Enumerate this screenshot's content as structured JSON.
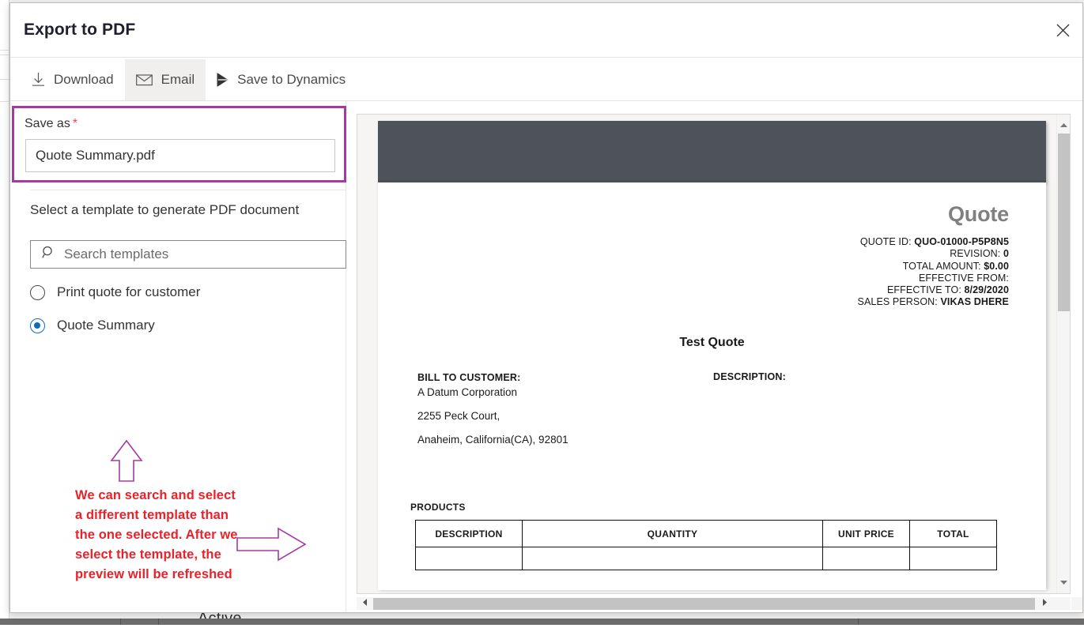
{
  "background": {
    "bottom_text": "Active"
  },
  "dialog": {
    "title": "Export to PDF",
    "close_icon": "close-icon"
  },
  "command_bar": {
    "items": [
      {
        "label": "Download",
        "icon": "download-icon",
        "selected": false
      },
      {
        "label": "Email",
        "icon": "envelope-icon",
        "selected": true
      },
      {
        "label": "Save to Dynamics",
        "icon": "send-icon",
        "selected": false
      }
    ]
  },
  "left_panel": {
    "save_as": {
      "label": "Save as",
      "required_marker": "*",
      "value": "Quote Summary.pdf",
      "highlight_color": "#a33ba3"
    },
    "template_section": {
      "label": "Select a template to generate PDF document",
      "search": {
        "placeholder": "Search templates",
        "value": "",
        "icon": "search-icon"
      },
      "options": [
        {
          "label": "Print quote for customer",
          "selected": false
        },
        {
          "label": "Quote Summary",
          "selected": true
        }
      ]
    },
    "annotation": {
      "text": "We can search and select a different template than the one selected. After we select the template, the preview will be refreshed",
      "text_color": "#e8222b",
      "arrow_color": "#a33ba3",
      "up_arrow_icon": "arrow-up-icon",
      "right_arrow_icon": "arrow-right-icon"
    }
  },
  "preview": {
    "document": {
      "title": "Quote",
      "meta": [
        {
          "label": "QUOTE ID:",
          "value": "QUO-01000-P5P8N5"
        },
        {
          "label": "REVISION:",
          "value": "0"
        },
        {
          "label": "TOTAL AMOUNT:",
          "value": "$0.00"
        },
        {
          "label": "EFFECTIVE FROM:",
          "value": ""
        },
        {
          "label": "EFFECTIVE TO:",
          "value": "8/29/2020"
        },
        {
          "label": "SALES PERSON:",
          "value": "VIKAS DHERE"
        }
      ],
      "heading": "Test Quote",
      "bill_to_header": "BILL TO CUSTOMER:",
      "bill_to_lines": [
        "A Datum Corporation",
        "2255 Peck Court,",
        "Anaheim, California(CA), 92801"
      ],
      "description_header": "DESCRIPTION:",
      "products_label": "PRODUCTS",
      "products_table": {
        "columns": [
          "DESCRIPTION",
          "QUANTITY",
          "UNIT PRICE",
          "TOTAL"
        ],
        "rows": [
          [
            "",
            "",
            "",
            ""
          ]
        ]
      }
    },
    "scrollbars": {
      "vertical_up_icon": "caret-up-icon",
      "vertical_down_icon": "caret-down-icon",
      "horizontal_left_icon": "caret-left-icon",
      "horizontal_right_icon": "caret-right-icon"
    }
  }
}
